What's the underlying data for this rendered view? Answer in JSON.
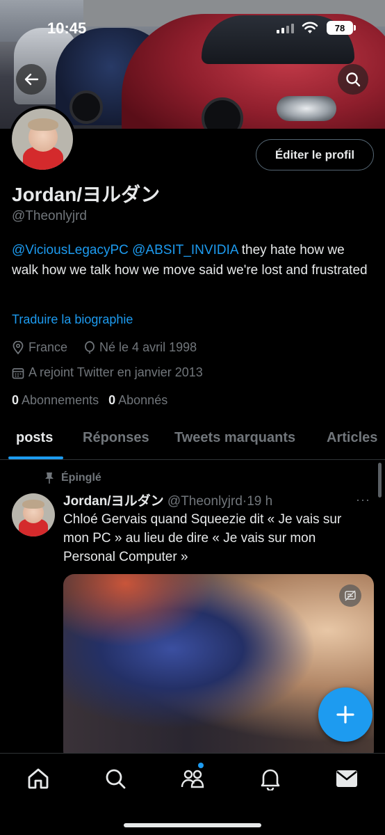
{
  "status_bar": {
    "time": "10:45",
    "battery": "78"
  },
  "header": {
    "back_icon": "arrow-left-icon",
    "search_icon": "search-icon"
  },
  "profile": {
    "edit_label": "Éditer le profil",
    "name": "Jordan/ヨルダン",
    "handle": "@Theonlyjrd",
    "bio": {
      "mention1": "@ViciousLegacyPC",
      "mention2": "@ABSIT_INVIDIA",
      "text": " they hate how we walk how we talk how we move said we're lost and frustrated"
    },
    "translate_label": "Traduire la biographie",
    "location": "France",
    "birth": "Né le 4 avril 1998",
    "joined": "A rejoint Twitter en janvier 2013",
    "following_count": "0",
    "following_label": "Abonnements",
    "followers_count": "0",
    "followers_label": "Abonnés"
  },
  "tabs": [
    {
      "label": "posts",
      "active": true
    },
    {
      "label": "Réponses",
      "active": false
    },
    {
      "label": "Tweets marquants",
      "active": false
    },
    {
      "label": "Articles",
      "active": false
    }
  ],
  "tweet": {
    "pinned_label": "Épinglé",
    "author_name": "Jordan/ヨルダン",
    "author_handle": "@Theonlyjrd",
    "separator": "·",
    "time": "19 h",
    "more": "···",
    "text": "Chloé Gervais quand Squeezie dit « Je vais sur mon PC » au lieu de dire « Je vais sur mon Personal Computer »"
  },
  "colors": {
    "accent": "#1d9bf0",
    "background": "#000000",
    "muted": "#71767b",
    "text": "#e7e9ea"
  },
  "bottom_nav": [
    "home-icon",
    "search-icon",
    "communities-icon",
    "notifications-icon",
    "messages-icon"
  ]
}
